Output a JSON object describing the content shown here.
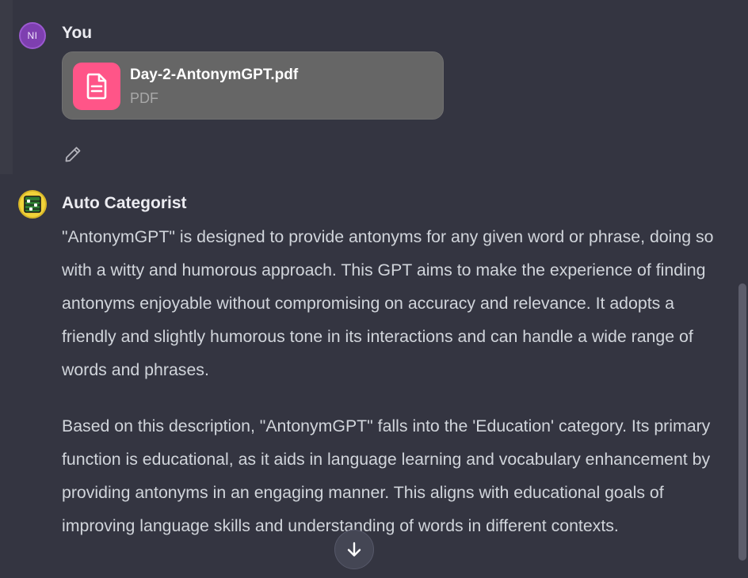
{
  "user_message": {
    "author": "You",
    "avatar_initials": "NI",
    "attachment": {
      "file_name": "Day-2-AntonymGPT.pdf",
      "file_type": "PDF",
      "icon": "document-icon"
    },
    "edit_icon": "pencil-icon"
  },
  "assistant_message": {
    "author": "Auto Categorist",
    "avatar_icon": "abacus-icon",
    "paragraphs": [
      "\"AntonymGPT\" is designed to provide antonyms for any given word or phrase, doing so with a witty and humorous approach. This GPT aims to make the experience of finding antonyms enjoyable without compromising on accuracy and relevance. It adopts a friendly and slightly humorous tone in its interactions and can handle a wide range of words and phrases.",
      "Based on this description, \"AntonymGPT\" falls into the 'Education' category. Its primary function is educational, as it aids in language learning and vocabulary enhancement by providing antonyms in an engaging manner. This aligns with educational goals of improving language skills and understanding of words in different contexts."
    ]
  },
  "scroll_button_icon": "arrow-down-icon",
  "colors": {
    "background": "#343541",
    "user_avatar": "#7e3fb0",
    "file_icon_bg": "#ff5588",
    "bot_avatar": "#f1d33a"
  }
}
